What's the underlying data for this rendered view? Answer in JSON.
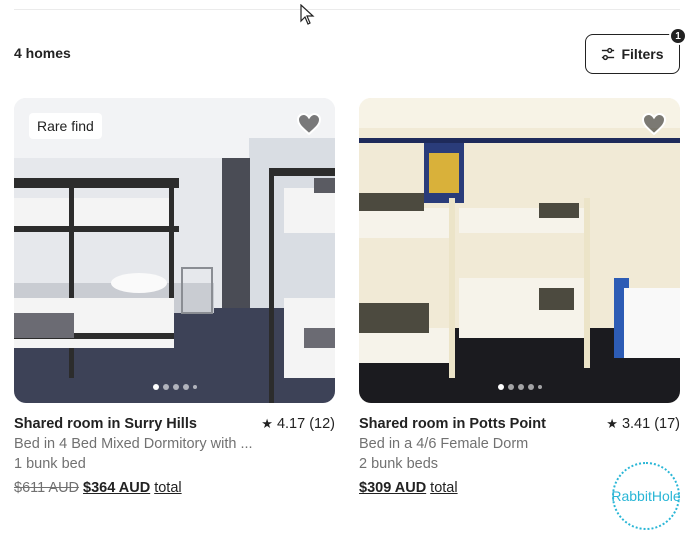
{
  "results": {
    "count_label": "4 homes"
  },
  "filters": {
    "label": "Filters",
    "badge": "1"
  },
  "listings": [
    {
      "badge": "Rare find",
      "title": "Shared room in Surry Hills",
      "rating": "4.17 (12)",
      "subtitle": "Bed in 4 Bed Mixed Dormitory with ...",
      "beds": "1 bunk bed",
      "old_price": "$611 AUD",
      "price": "$364 AUD",
      "price_suffix": "total",
      "photo_index": 1,
      "photo_count": 5
    },
    {
      "title": "Shared room in Potts Point",
      "rating": "3.41 (17)",
      "subtitle": "Bed in a 4/6  Female  Dorm",
      "beds": "2 bunk beds",
      "price": "$309 AUD",
      "price_suffix": "total",
      "host_logo": "RabbitHole",
      "photo_index": 1,
      "photo_count": 5
    }
  ],
  "icons": {
    "heart": "heart-icon",
    "star": "star-icon",
    "filters": "sliders-icon"
  },
  "colors": {
    "text": "#222222",
    "muted": "#717171",
    "host_logo": "#29b6d6"
  }
}
